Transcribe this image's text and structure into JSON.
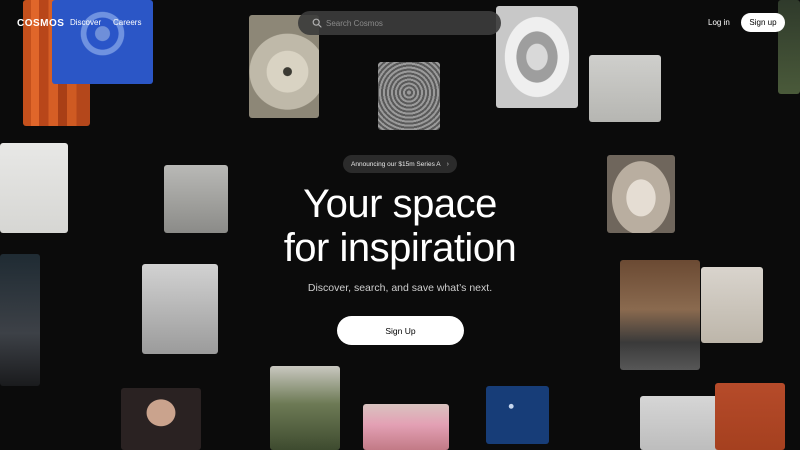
{
  "nav": {
    "logo": "COSMOS",
    "links": [
      "Discover",
      "Careers"
    ],
    "search_placeholder": "Search Cosmos",
    "login": "Log in",
    "signup": "Sign up"
  },
  "hero": {
    "announcement": "Announcing our $15m Series A",
    "announcement_chevron": "›",
    "headline_line1": "Your space",
    "headline_line2": "for inspiration",
    "subheadline": "Discover, search, and save what’s next.",
    "cta": "Sign Up"
  },
  "icons": {
    "search": "search-icon",
    "chevron": "chevron-right-icon"
  }
}
